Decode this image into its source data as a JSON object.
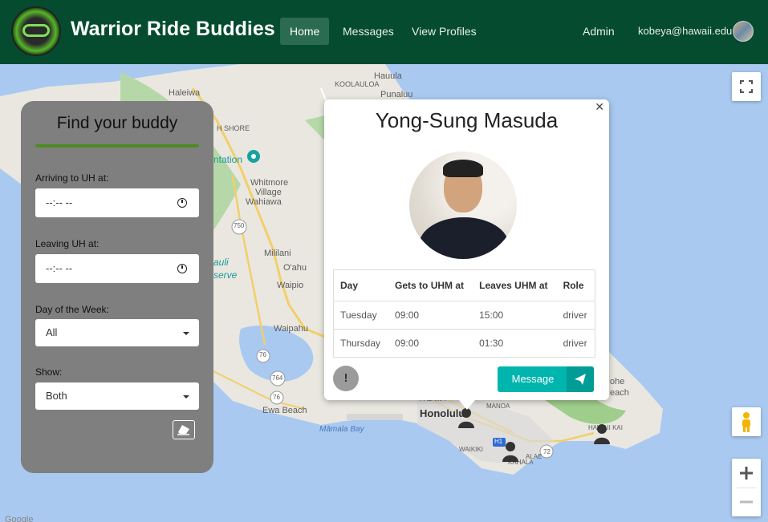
{
  "navbar": {
    "brand": "Warrior Ride Buddies",
    "links": [
      "Home",
      "Messages",
      "View Profiles"
    ],
    "active": "Home",
    "admin": "Admin",
    "user_email": "kobeya@hawaii.edu",
    "bg_color": "#044b30"
  },
  "map": {
    "labels": {
      "haleiwa": "Haleiwa",
      "koolauloa": "KOOLAULOA",
      "hauula": "Hauula",
      "punaluu": "Punaluu",
      "hshore": "H SHORE",
      "plantation": "ntation",
      "whitmore": "Whitmore",
      "village": "Village",
      "wahiawa": "Wahiawa",
      "r750": "750",
      "mililani": "Mililani",
      "oahu": "O'ahu",
      "auli": "auli",
      "serve": "serve",
      "waipio": "Waipio",
      "waipahu": "Waipahu",
      "r76": "76",
      "r764": "764",
      "r76b": "76",
      "ewabeach": "Ewa Beach",
      "mamalabay": "Māmala Bay",
      "honolulu": "Honolulu",
      "manoa": "MANOA",
      "palama": "PALAMA",
      "waikiki": "WAIKIKI",
      "kahala": "KAHALA",
      "alae": "ALAE",
      "r72": "72",
      "h1": "H1",
      "hawaiikai": "HAWAII KAI",
      "ohe": "ohe",
      "each": "each",
      "google": "Google"
    }
  },
  "finder": {
    "title": "Find your buddy",
    "arriving_label": "Arriving to UH at:",
    "arriving_value": "--:-- --",
    "leaving_label": "Leaving UH at:",
    "leaving_value": "--:-- --",
    "day_label": "Day of the Week:",
    "day_value": "All",
    "show_label": "Show:",
    "show_value": "Both"
  },
  "popup": {
    "name": "Yong-Sung Masuda",
    "columns": [
      "Day",
      "Gets to UHM at",
      "Leaves UHM at",
      "Role"
    ],
    "rows": [
      [
        "Tuesday",
        "09:00",
        "15:00",
        "driver"
      ],
      [
        "Thursday",
        "09:00",
        "01:30",
        "driver"
      ]
    ],
    "warn_label": "!",
    "message_label": "Message",
    "message_color": "#00b5ad"
  }
}
